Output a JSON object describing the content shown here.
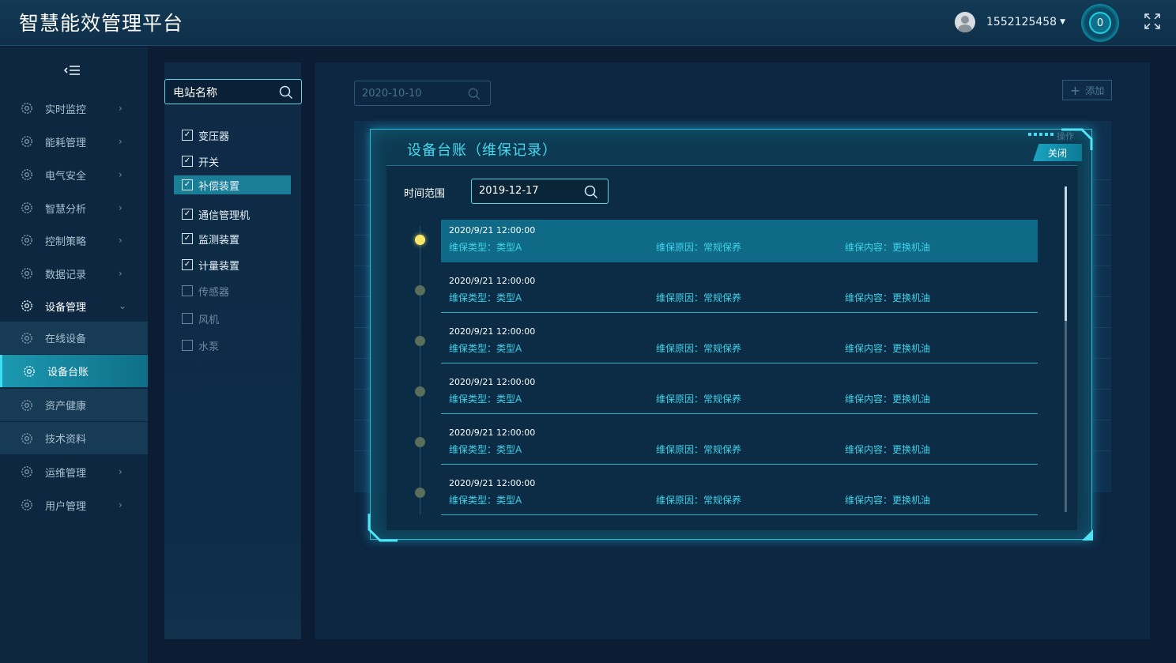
{
  "header": {
    "title": "智慧能效管理平台",
    "username": "1552125458",
    "notification_count": "0"
  },
  "sidebar": {
    "items": [
      {
        "label": "实时监控",
        "icon": "gear-icon"
      },
      {
        "label": "能耗管理",
        "icon": "gear-icon"
      },
      {
        "label": "电气安全",
        "icon": "gear-icon"
      },
      {
        "label": "智慧分析",
        "icon": "gear-icon"
      },
      {
        "label": "控制策略",
        "icon": "gear-icon"
      },
      {
        "label": "数据记录",
        "icon": "gear-icon"
      },
      {
        "label": "设备管理",
        "icon": "gear-icon",
        "expanded": true
      },
      {
        "label": "在线设备",
        "icon": "gear-icon",
        "sub": true
      },
      {
        "label": "设备台账",
        "icon": "gear-icon",
        "sub": true,
        "selected": true
      },
      {
        "label": "资产健康",
        "icon": "gear-icon",
        "sub": true
      },
      {
        "label": "技术资料",
        "icon": "gear-icon",
        "sub": true
      },
      {
        "label": "运维管理",
        "icon": "gear-icon"
      },
      {
        "label": "用户管理",
        "icon": "gear-icon"
      }
    ]
  },
  "filter": {
    "search_label": "电站名称",
    "items": [
      {
        "label": "变压器",
        "checked": true
      },
      {
        "label": "开关",
        "checked": true
      },
      {
        "label": "补偿装置",
        "checked": true,
        "highlighted": true
      },
      {
        "label": "通信管理机",
        "checked": true
      },
      {
        "label": "监测装置",
        "checked": true
      },
      {
        "label": "计量装置",
        "checked": true
      },
      {
        "label": "传感器",
        "checked": false
      },
      {
        "label": "风机",
        "checked": false
      },
      {
        "label": "水泵",
        "checked": false
      }
    ]
  },
  "main": {
    "date_filter": "2020-10-10",
    "add_label": "添加",
    "operate_label": "操作"
  },
  "modal": {
    "title": "设备台账（维保记录）",
    "close_label": "关闭",
    "range_label": "时间范围",
    "range_value": "2019-12-17",
    "records": [
      {
        "time": "2020/9/21 12:00:00",
        "type": "维保类型：类型A",
        "reason": "维保原因：常规保养",
        "content": "维保内容：更换机油",
        "active": true
      },
      {
        "time": "2020/9/21 12:00:00",
        "type": "维保类型：类型A",
        "reason": "维保原因：常规保养",
        "content": "维保内容：更换机油",
        "active": false
      },
      {
        "time": "2020/9/21 12:00:00",
        "type": "维保类型：类型A",
        "reason": "维保原因：常规保养",
        "content": "维保内容：更换机油",
        "active": false
      },
      {
        "time": "2020/9/21 12:00:00",
        "type": "维保类型：类型A",
        "reason": "维保原因：常规保养",
        "content": "维保内容：更换机油",
        "active": false
      },
      {
        "time": "2020/9/21 12:00:00",
        "type": "维保类型：类型A",
        "reason": "维保原因：常规保养",
        "content": "维保内容：更换机油",
        "active": false
      },
      {
        "time": "2020/9/21 12:00:00",
        "type": "维保类型：类型A",
        "reason": "维保原因：常规保养",
        "content": "维保内容：更换机油",
        "active": false
      }
    ]
  },
  "colors": {
    "accent": "#2ab9d4",
    "highlight": "#47d9ef",
    "background": "#0b1c33",
    "active_dot": "#f7e86a"
  }
}
